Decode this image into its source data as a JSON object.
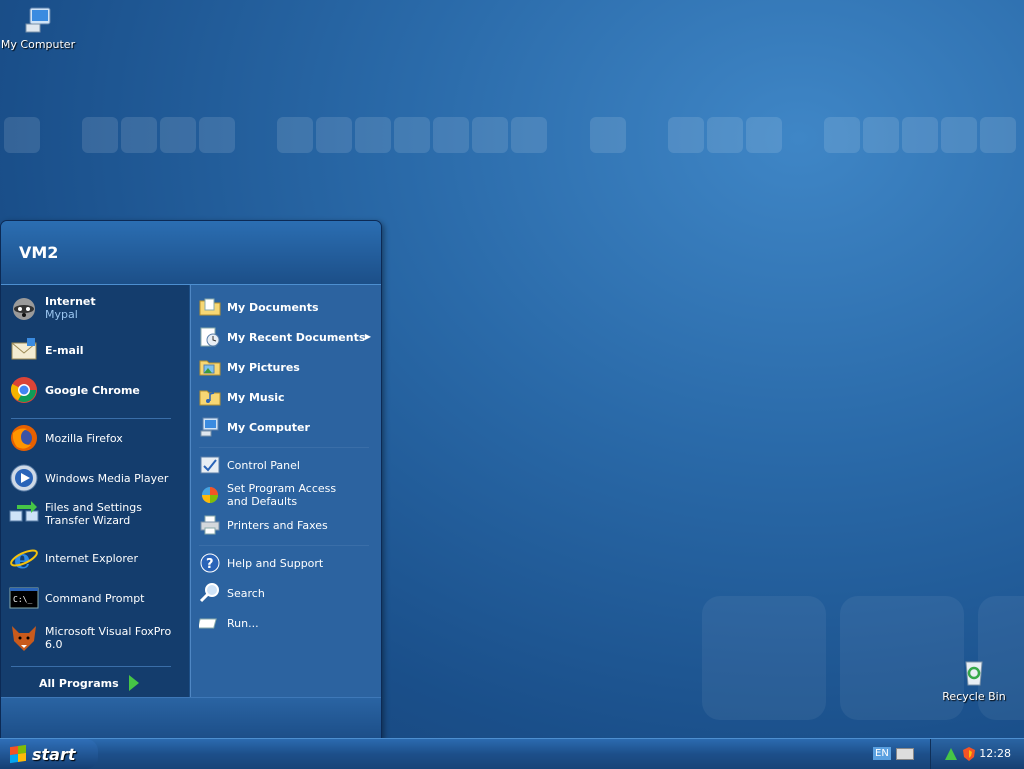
{
  "desktop": {
    "icons": [
      {
        "label": "My Computer",
        "icon": "my-computer-icon"
      },
      {
        "label": "Recycle Bin",
        "icon": "recycle-bin-icon"
      }
    ]
  },
  "start_menu": {
    "user": "VM2",
    "left": {
      "pinned": [
        {
          "label": "Internet",
          "sub": "Mypal",
          "icon": "raccoon-browser-icon"
        },
        {
          "label": "E-mail",
          "icon": "email-icon"
        },
        {
          "label": "Google Chrome",
          "icon": "chrome-icon"
        }
      ],
      "recent": [
        {
          "label": "Mozilla Firefox",
          "icon": "firefox-icon"
        },
        {
          "label": "Windows Media Player",
          "icon": "media-player-icon"
        },
        {
          "label": "Files and Settings Transfer Wizard",
          "icon": "transfer-wizard-icon"
        },
        {
          "label": "Internet Explorer",
          "icon": "internet-explorer-icon"
        },
        {
          "label": "Command Prompt",
          "icon": "command-prompt-icon"
        },
        {
          "label": "Microsoft Visual FoxPro 6.0",
          "icon": "foxpro-icon"
        }
      ],
      "all_programs": "All Programs"
    },
    "right": {
      "group1": [
        {
          "label": "My Documents",
          "icon": "folder-icon"
        },
        {
          "label": "My Recent Documents",
          "icon": "recent-documents-icon"
        },
        {
          "label": "My Pictures",
          "icon": "pictures-folder-icon"
        },
        {
          "label": "My Music",
          "icon": "music-folder-icon"
        },
        {
          "label": "My Computer",
          "icon": "my-computer-icon"
        }
      ],
      "group2": [
        {
          "label": "Control Panel",
          "icon": "control-panel-icon"
        },
        {
          "label": "Set Program Access and Defaults",
          "icon": "program-defaults-icon"
        },
        {
          "label": "Printers and Faxes",
          "icon": "printer-icon"
        }
      ],
      "group3": [
        {
          "label": "Help and Support",
          "icon": "help-icon"
        },
        {
          "label": "Search",
          "icon": "search-icon"
        },
        {
          "label": "Run...",
          "icon": "run-icon"
        }
      ]
    }
  },
  "taskbar": {
    "start_label": "start",
    "language": "EN",
    "clock": "12:28"
  },
  "colors": {
    "desktop": "#1a4f8a",
    "menu_left": "#143d6d",
    "menu_right": "#2c63a0",
    "all_programs_arrow": "#46c646"
  }
}
